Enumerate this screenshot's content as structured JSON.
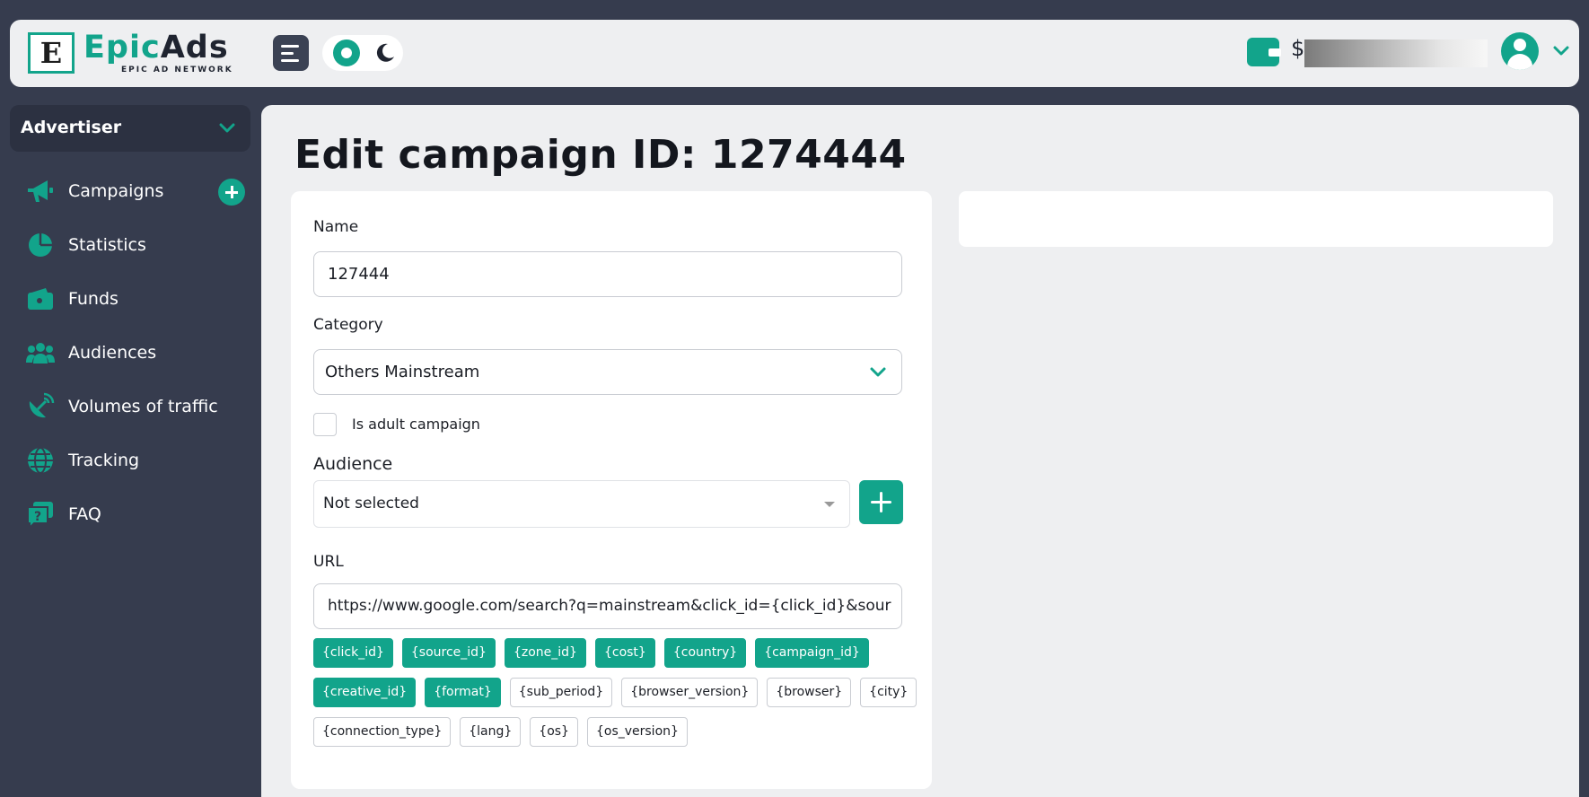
{
  "header": {
    "logo_letter": "E",
    "brand_part1": "Epic",
    "brand_part2": "Ads",
    "brand_subtitle": "EPIC AD NETWORK",
    "balance_currency": "$"
  },
  "sidebar": {
    "role": "Advertiser",
    "items": [
      {
        "label": "Campaigns",
        "icon": "megaphone-icon"
      },
      {
        "label": "Statistics",
        "icon": "pie-chart-icon"
      },
      {
        "label": "Funds",
        "icon": "wallet-icon"
      },
      {
        "label": "Audiences",
        "icon": "users-icon"
      },
      {
        "label": "Volumes of traffic",
        "icon": "satellite-dish-icon"
      },
      {
        "label": "Tracking",
        "icon": "globe-icon"
      },
      {
        "label": "FAQ",
        "icon": "faq-icon"
      }
    ]
  },
  "main": {
    "title": "Edit campaign ID: 1274444",
    "form": {
      "name_label": "Name",
      "name_value": "127444",
      "category_label": "Category",
      "category_value": "Others Mainstream",
      "adult_label": "Is adult campaign",
      "audience_label": "Audience",
      "audience_value": "Not selected",
      "url_label": "URL",
      "url_value": "https://www.google.com/search?q=mainstream&click_id={click_id}&sour",
      "tags_active": [
        "{click_id}",
        "{source_id}",
        "{zone_id}",
        "{cost}",
        "{country}",
        "{campaign_id}",
        "{creative_id}",
        "{format}"
      ],
      "tags_inactive": [
        "{sub_period}",
        "{browser_version}",
        "{browser}",
        "{city}",
        "{connection_type}",
        "{lang}",
        "{os}",
        "{os_version}"
      ]
    }
  },
  "colors": {
    "accent": "#12a48b",
    "background": "#363c4e",
    "panel": "#eeeff1"
  }
}
